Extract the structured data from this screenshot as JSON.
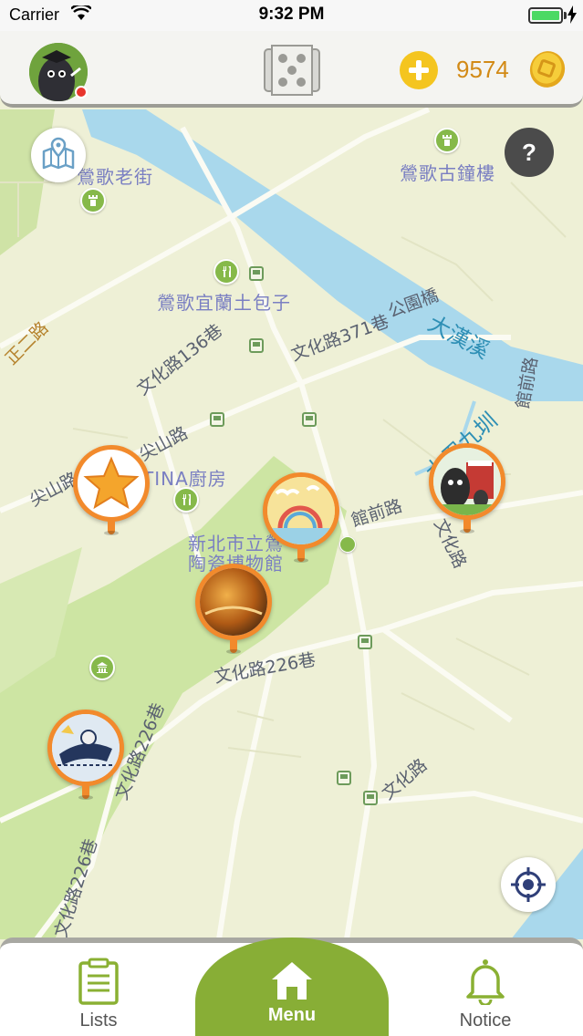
{
  "status_bar": {
    "carrier": "Carrier",
    "time": "9:32 PM",
    "icons": [
      "wifi-icon",
      "battery-icon",
      "charging-icon"
    ]
  },
  "header": {
    "avatar": "user-avatar",
    "center_icon": "map-dice-icon",
    "add_icon": "plus-icon",
    "coins": "9574",
    "coin_icon": "coin-icon"
  },
  "map": {
    "place_labels": [
      "鶯歌老街",
      "鶯歌古鐘樓",
      "鶯歌宜蘭土包子",
      "TINA廚房",
      "新北市立鶯",
      "陶瓷博物館"
    ],
    "road_labels": [
      "文化路136巷",
      "文化路371巷",
      "公園橋",
      "尖山路",
      "尖山路",
      "館前路",
      "館前路",
      "文化路",
      "文化路226巷",
      "文化路226巷",
      "文化路",
      "文化路226巷",
      "正二路"
    ],
    "river_labels": [
      "大漢溪",
      "大用九圳"
    ],
    "pins": [
      {
        "name": "star-pin",
        "kind": "favorite"
      },
      {
        "name": "carnival-pin",
        "kind": "attraction"
      },
      {
        "name": "passport-pin",
        "kind": "passport"
      },
      {
        "name": "ceramic-pin",
        "kind": "museum"
      },
      {
        "name": "game-pin",
        "kind": "activity"
      }
    ]
  },
  "floating_buttons": {
    "map_toggle": "map-pin-icon",
    "help": "?",
    "locate": "crosshair-icon"
  },
  "tabs": {
    "lists": "Lists",
    "menu": "Menu",
    "notice": "Notice"
  },
  "colors": {
    "accent_green": "#88ae36",
    "pin_orange": "#f28a2c",
    "coin_gold": "#d28a16",
    "river_blue": "#a9d8ec"
  }
}
